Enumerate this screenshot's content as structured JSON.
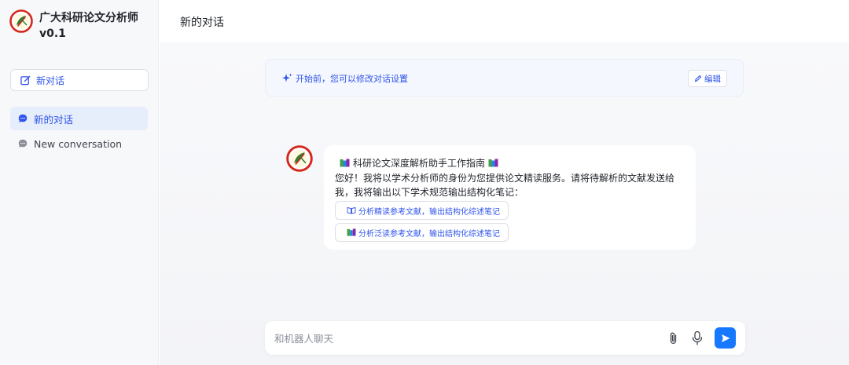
{
  "sidebar": {
    "app_title": "广大科研论文分析师",
    "app_version": "v0.1",
    "new_chat_label": "新对话",
    "conversations": [
      {
        "label": "新的对话",
        "active": true
      },
      {
        "label": "New conversation",
        "active": false
      }
    ]
  },
  "header": {
    "title": "新的对话"
  },
  "banner": {
    "text": "开始前，您可以修改对话设置",
    "edit_label": "编辑"
  },
  "message": {
    "title": "科研论文深度解析助手工作指南",
    "body": "您好！我将以学术分析师的身份为您提供论文精读服务。请将待解析的文献发送给我，我将输出以下学术规范输出结构化笔记：",
    "suggestions": [
      {
        "icon": "open-book-icon",
        "label": "分析精读参考文献，输出结构化综述笔记"
      },
      {
        "icon": "books-icon",
        "label": "分析泛读参考文献，输出结构化综述笔记"
      }
    ]
  },
  "input": {
    "placeholder": "和机器人聊天",
    "value": ""
  },
  "colors": {
    "accent": "#2f54eb",
    "send_button": "#1677ff",
    "logo_red": "#d4281e",
    "logo_green": "#2e7d32"
  }
}
